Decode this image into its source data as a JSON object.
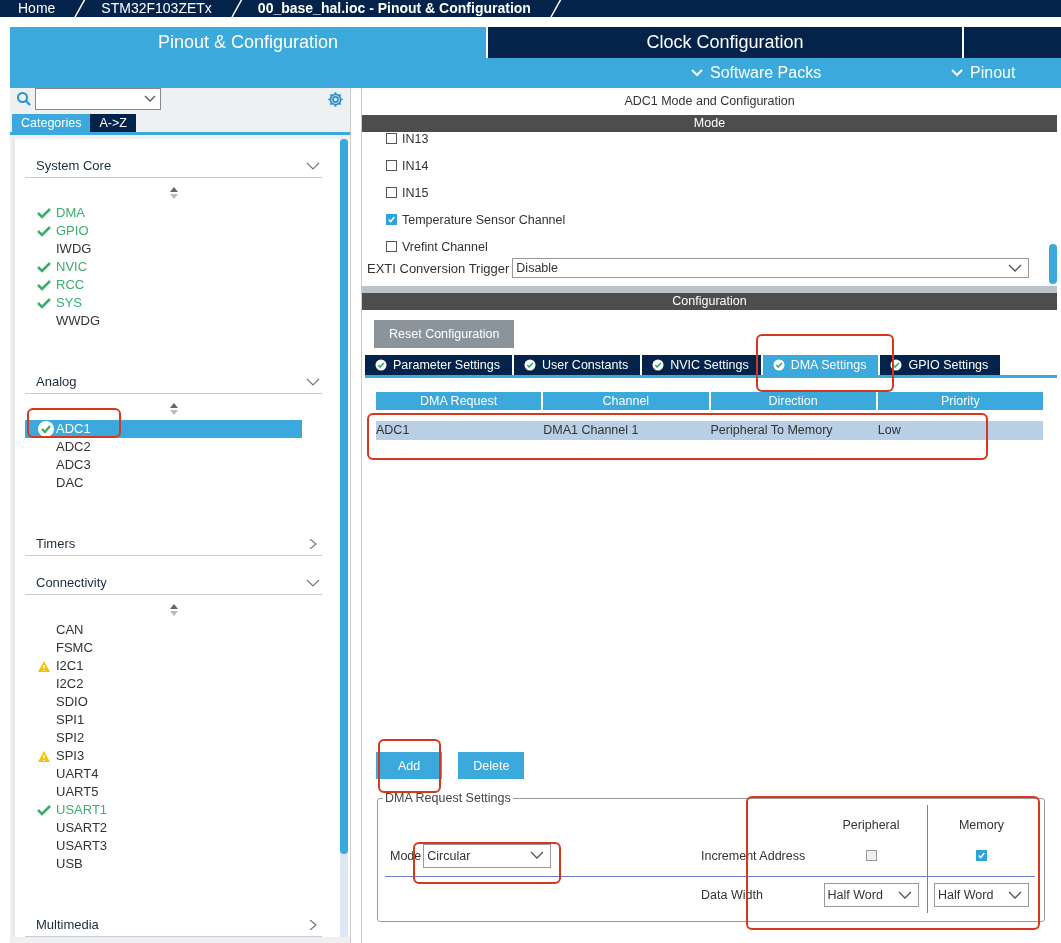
{
  "breadcrumb": [
    {
      "label": "Home",
      "selected": false
    },
    {
      "label": "STM32F103ZETx",
      "selected": false
    },
    {
      "label": "00_base_hal.ioc - Pinout & Configuration",
      "selected": true
    }
  ],
  "main_tabs": [
    {
      "label": "Pinout & Configuration",
      "selected": true
    },
    {
      "label": "Clock Configuration",
      "selected": false
    }
  ],
  "menus": [
    {
      "label": "Software Packs"
    },
    {
      "label": "Pinout"
    }
  ],
  "sidebar": {
    "view_tabs": [
      {
        "label": "Categories",
        "selected": true
      },
      {
        "label": "A->Z",
        "selected": false
      }
    ],
    "groups": [
      {
        "title": "System Core",
        "expanded": true,
        "items": [
          {
            "label": "DMA",
            "kind": "ok",
            "selected": false
          },
          {
            "label": "GPIO",
            "kind": "ok",
            "selected": false
          },
          {
            "label": "IWDG",
            "kind": "plain",
            "selected": false
          },
          {
            "label": "NVIC",
            "kind": "ok",
            "selected": false
          },
          {
            "label": "RCC",
            "kind": "ok",
            "selected": false
          },
          {
            "label": "SYS",
            "kind": "ok",
            "selected": false
          },
          {
            "label": "WWDG",
            "kind": "plain",
            "selected": false
          }
        ]
      },
      {
        "title": "Analog",
        "expanded": true,
        "items": [
          {
            "label": "ADC1",
            "kind": "ok",
            "selected": true
          },
          {
            "label": "ADC2",
            "kind": "plain",
            "selected": false
          },
          {
            "label": "ADC3",
            "kind": "plain",
            "selected": false
          },
          {
            "label": "DAC",
            "kind": "plain",
            "selected": false
          }
        ]
      },
      {
        "title": "Timers",
        "expanded": false
      },
      {
        "title": "Connectivity",
        "expanded": true,
        "items": [
          {
            "label": "CAN",
            "kind": "plain",
            "selected": false
          },
          {
            "label": "FSMC",
            "kind": "plain",
            "selected": false
          },
          {
            "label": "I2C1",
            "kind": "warn",
            "selected": false
          },
          {
            "label": "I2C2",
            "kind": "plain",
            "selected": false
          },
          {
            "label": "SDIO",
            "kind": "plain",
            "selected": false
          },
          {
            "label": "SPI1",
            "kind": "plain",
            "selected": false
          },
          {
            "label": "SPI2",
            "kind": "plain",
            "selected": false
          },
          {
            "label": "SPI3",
            "kind": "warn",
            "selected": false
          },
          {
            "label": "UART4",
            "kind": "plain",
            "selected": false
          },
          {
            "label": "UART5",
            "kind": "plain",
            "selected": false
          },
          {
            "label": "USART1",
            "kind": "ok",
            "selected": false
          },
          {
            "label": "USART2",
            "kind": "plain",
            "selected": false
          },
          {
            "label": "USART3",
            "kind": "plain",
            "selected": false
          },
          {
            "label": "USB",
            "kind": "plain",
            "selected": false
          }
        ]
      },
      {
        "title": "Multimedia",
        "expanded": false
      }
    ]
  },
  "panel_title": "ADC1 Mode and Configuration",
  "mode": {
    "header": "Mode",
    "channels": [
      {
        "label": "IN13",
        "checked": false
      },
      {
        "label": "IN14",
        "checked": false
      },
      {
        "label": "IN15",
        "checked": false
      },
      {
        "label": "Temperature Sensor Channel",
        "checked": true
      },
      {
        "label": "Vrefint Channel",
        "checked": false
      }
    ],
    "trigger": {
      "label": "EXTI Conversion Trigger",
      "value": "Disable"
    }
  },
  "configuration": {
    "header": "Configuration",
    "reset_button": "Reset Configuration",
    "tabs": [
      {
        "label": "Parameter Settings",
        "selected": false
      },
      {
        "label": "User Constants",
        "selected": false
      },
      {
        "label": "NVIC Settings",
        "selected": false
      },
      {
        "label": "DMA Settings",
        "selected": true
      },
      {
        "label": "GPIO Settings",
        "selected": false
      }
    ],
    "table": {
      "columns": [
        "DMA Request",
        "Channel",
        "Direction",
        "Priority"
      ],
      "rows": [
        {
          "cells": [
            "ADC1",
            "DMA1 Channel 1",
            "Peripheral To Memory",
            "Low"
          ],
          "selected": true
        }
      ]
    },
    "buttons": [
      "Add",
      "Delete"
    ],
    "request_settings": {
      "legend": "DMA Request Settings",
      "mode": {
        "label": "Mode",
        "value": "Circular"
      },
      "peripheral_label": "Peripheral",
      "memory_label": "Memory",
      "increment": {
        "label": "Increment Address",
        "peripheral_checked": false,
        "memory_checked": true
      },
      "data_width": {
        "label": "Data Width",
        "peripheral": "Half Word",
        "memory": "Half Word"
      }
    }
  }
}
